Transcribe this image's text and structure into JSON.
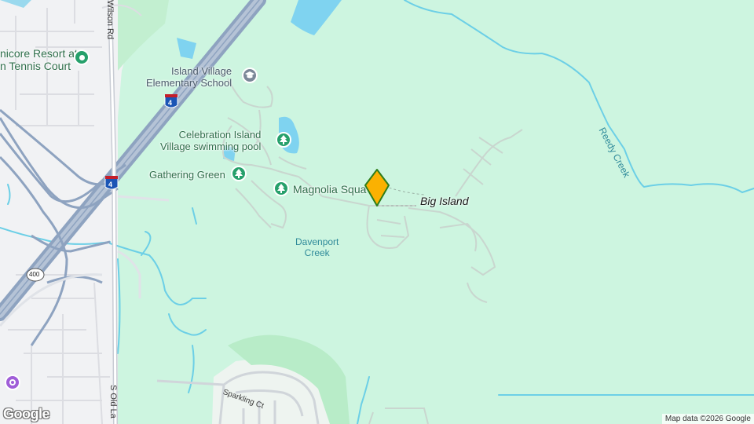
{
  "map": {
    "labels": {
      "big_island": "Big Island",
      "davenport_creek": "Davenport\nCreek",
      "reedy_creek": "Reedy Creek",
      "island_village_school": "Island Village\nElementary School",
      "celebration_pool": "Celebration Island\nVillage swimming pool",
      "gathering_green": "Gathering Green",
      "magnolia_square": "Magnolia Squa",
      "resort_partial": "nicore Resort at\nn Tennis Court",
      "wilson_rd": "Wilson Rd",
      "s_old_lake": "S Old La",
      "sparkling_ct": "Sparkling Ct",
      "shield_400": "400",
      "shield_i4": "4"
    },
    "icons": {
      "park": "tree-icon",
      "school": "school-icon",
      "resort": "place-dot-icon",
      "purple_poi": "purple-poi-icon",
      "marker": "location-marker-icon"
    },
    "colors": {
      "land": "#cdf5e0",
      "urban": "#f1f2f4",
      "water": "#7fd3f0",
      "highway": "#8ea3c0",
      "park_poi": "#26a06b",
      "marker": "#fbb101",
      "marker_outline": "#2f7d1a"
    }
  },
  "attribution": {
    "logo": "Google",
    "map_data": "Map data ©2026 Google"
  }
}
